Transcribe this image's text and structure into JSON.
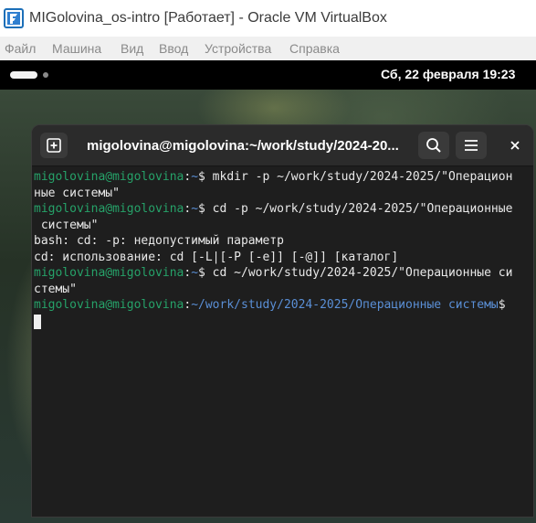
{
  "host": {
    "title": "MIGolovina_os-intro [Работает] - Oracle VM VirtualBox",
    "menu": [
      "Файл",
      "Машина",
      "Вид",
      "Ввод",
      "Устройства",
      "Справка"
    ]
  },
  "guest": {
    "clock": "Сб, 22 февраля  19:23"
  },
  "terminal": {
    "title": "migolovina@migolovina:~/work/study/2024-20...",
    "lines": [
      {
        "user": "migolovina@migolovina",
        "sep": ":",
        "path": "~",
        "rest": "$ mkdir -p ~/work/study/2024-2025/\"Операцион"
      },
      {
        "text": "ные системы\""
      },
      {
        "user": "migolovina@migolovina",
        "sep": ":",
        "path": "~",
        "rest": "$ cd -p ~/work/study/2024-2025/\"Операционные"
      },
      {
        "text": " системы\""
      },
      {
        "text": "bash: cd: -p: недопустимый параметр"
      },
      {
        "text": "cd: использование: cd [-L|[-P [-e]] [-@]] [каталог]"
      },
      {
        "user": "migolovina@migolovina",
        "sep": ":",
        "path": "~",
        "rest": "$ cd ~/work/study/2024-2025/\"Операционные си"
      },
      {
        "text": "стемы\""
      },
      {
        "user": "migolovina@migolovina",
        "sep": ":",
        "path": "~/work/study/2024-2025/Операционные системы",
        "rest": "$"
      }
    ]
  },
  "colors": {
    "prompt_user": "#26a269",
    "prompt_path": "#5a8fd6",
    "terminal_bg": "#1e1e1e"
  }
}
